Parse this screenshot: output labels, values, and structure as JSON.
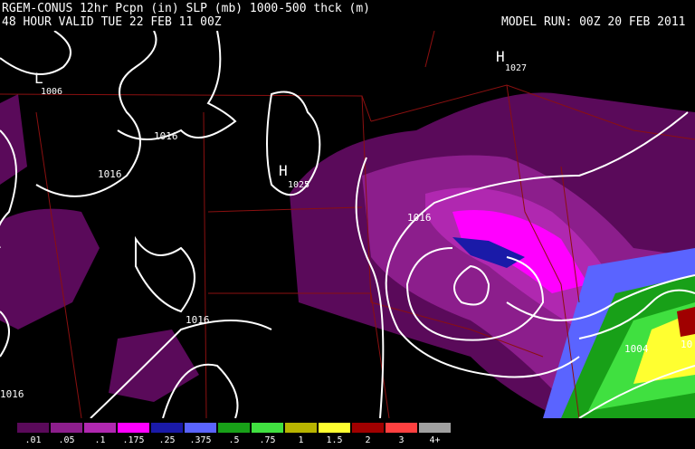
{
  "header": {
    "title_line1": "RGEM-CONUS 12hr Pcpn (in) SLP (mb) 1000-500 thck (m)",
    "title_line2": "48 HOUR VALID TUE 22 FEB 11 00Z",
    "model_run": "MODEL RUN: 00Z 20 FEB 2011"
  },
  "map": {
    "pressure_centers": [
      {
        "type": "L",
        "value": "1006"
      },
      {
        "type": "H",
        "value": "1025"
      },
      {
        "type": "H",
        "value": "1027"
      }
    ],
    "isobar_labels": [
      "1016",
      "1016",
      "1016",
      "1016",
      "1016",
      "1004",
      "10"
    ]
  },
  "legend": {
    "labels": [
      ".01",
      ".05",
      ".1",
      ".175",
      ".25",
      ".375",
      ".5",
      ".75",
      "1",
      "1.5",
      "2",
      "3",
      "4+"
    ],
    "colors": [
      "#5a0a5a",
      "#8c1e8c",
      "#b028b0",
      "#ff00ff",
      "#1a1aa8",
      "#5a64ff",
      "#18a018",
      "#40e040",
      "#b8b400",
      "#ffff30",
      "#a00000",
      "#ff4040",
      "#a0a0a0"
    ]
  }
}
